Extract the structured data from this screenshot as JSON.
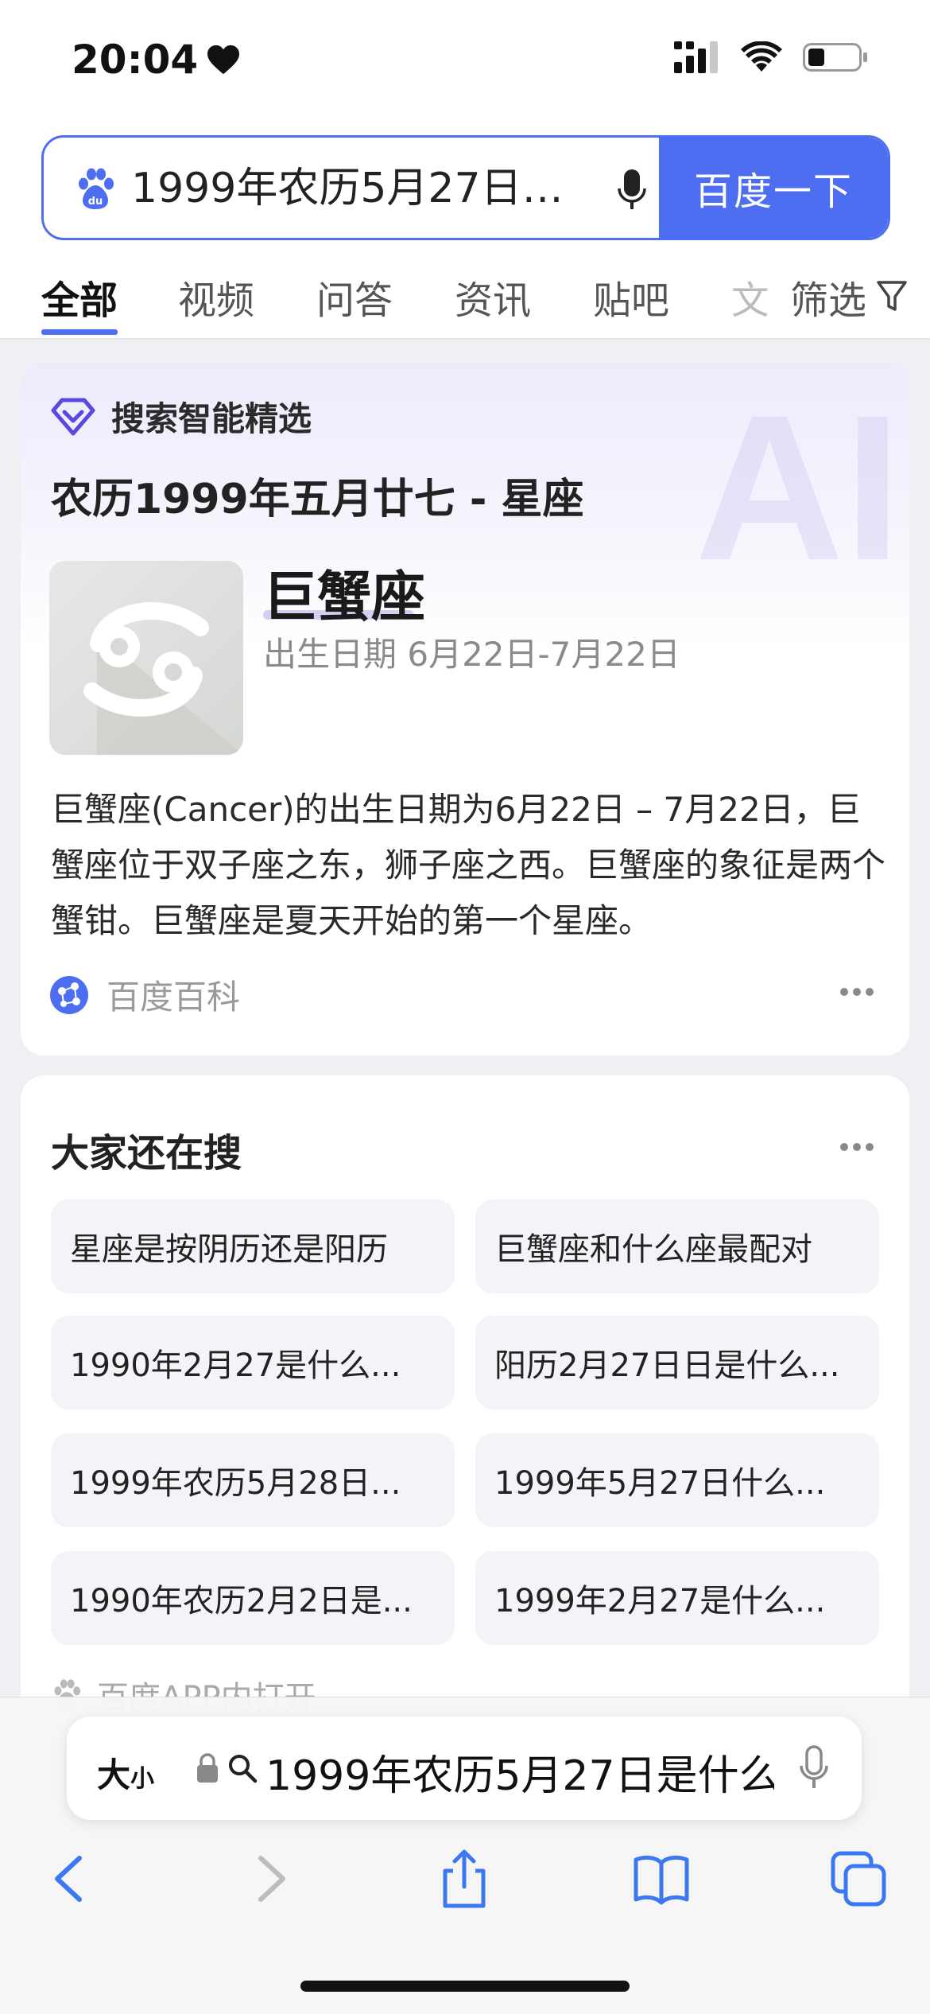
{
  "status_bar": {
    "time": "20:04"
  },
  "search": {
    "query": "1999年农历5月27日…",
    "button_label": "百度一下"
  },
  "tabs": [
    {
      "label": "全部",
      "active": true
    },
    {
      "label": "视频"
    },
    {
      "label": "问答"
    },
    {
      "label": "资讯"
    },
    {
      "label": "贴吧"
    },
    {
      "label": "文"
    }
  ],
  "filter_label": "筛选",
  "ai_card": {
    "badge": "搜索智能精选",
    "watermark": "AI",
    "title": "农历1999年五月廿七 - 星座",
    "zodiac_name": "巨蟹座",
    "zodiac_date": "出生日期 6月22日-7月22日",
    "body": "巨蟹座(Cancer)的出生日期为6月22日 – 7月22日，巨蟹座位于双子座之东，狮子座之西。巨蟹座的象征是两个蟹钳。巨蟹座是夏天开始的第一个星座。",
    "source": "百度百科"
  },
  "related": {
    "title": "大家还在搜",
    "items": [
      "星座是按阴历还是阳历",
      "巨蟹座和什么座最配对",
      "1990年2月27是什么...",
      "阳历2月27日日是什么...",
      "1999年农历5月28日...",
      "1999年5月27日什么...",
      "1990年农历2月2日是...",
      "1999年2月27是什么..."
    ],
    "app_open": "百度APP内打开"
  },
  "safari": {
    "text_size_big": "大",
    "text_size_small": "小",
    "url_text": "1999年农历5月27日是什么"
  },
  "colors": {
    "accent": "#4e6ef2",
    "page_bg": "#eef0f4"
  }
}
